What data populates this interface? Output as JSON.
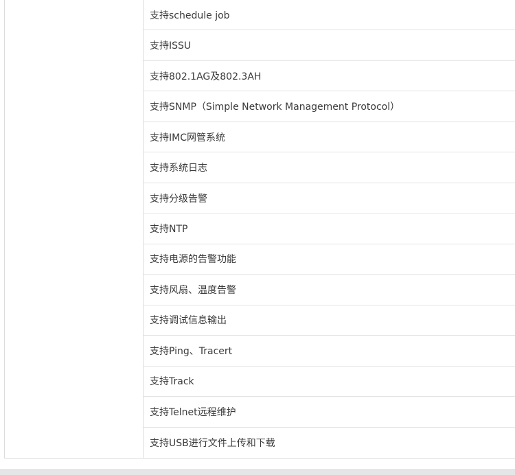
{
  "features": [
    "支持schedule job",
    "支持ISSU",
    "支持802.1AG及802.3AH",
    "支持SNMP（Simple Network Management Protocol）",
    "支持IMC网管系统",
    "支持系统日志",
    "支持分级告警",
    "支持NTP",
    "支持电源的告警功能",
    "支持风扇、温度告警",
    "支持调试信息输出",
    "支持Ping、Tracert",
    "支持Track",
    "支持Telnet远程维护",
    "支持USB进行文件上传和下载"
  ]
}
